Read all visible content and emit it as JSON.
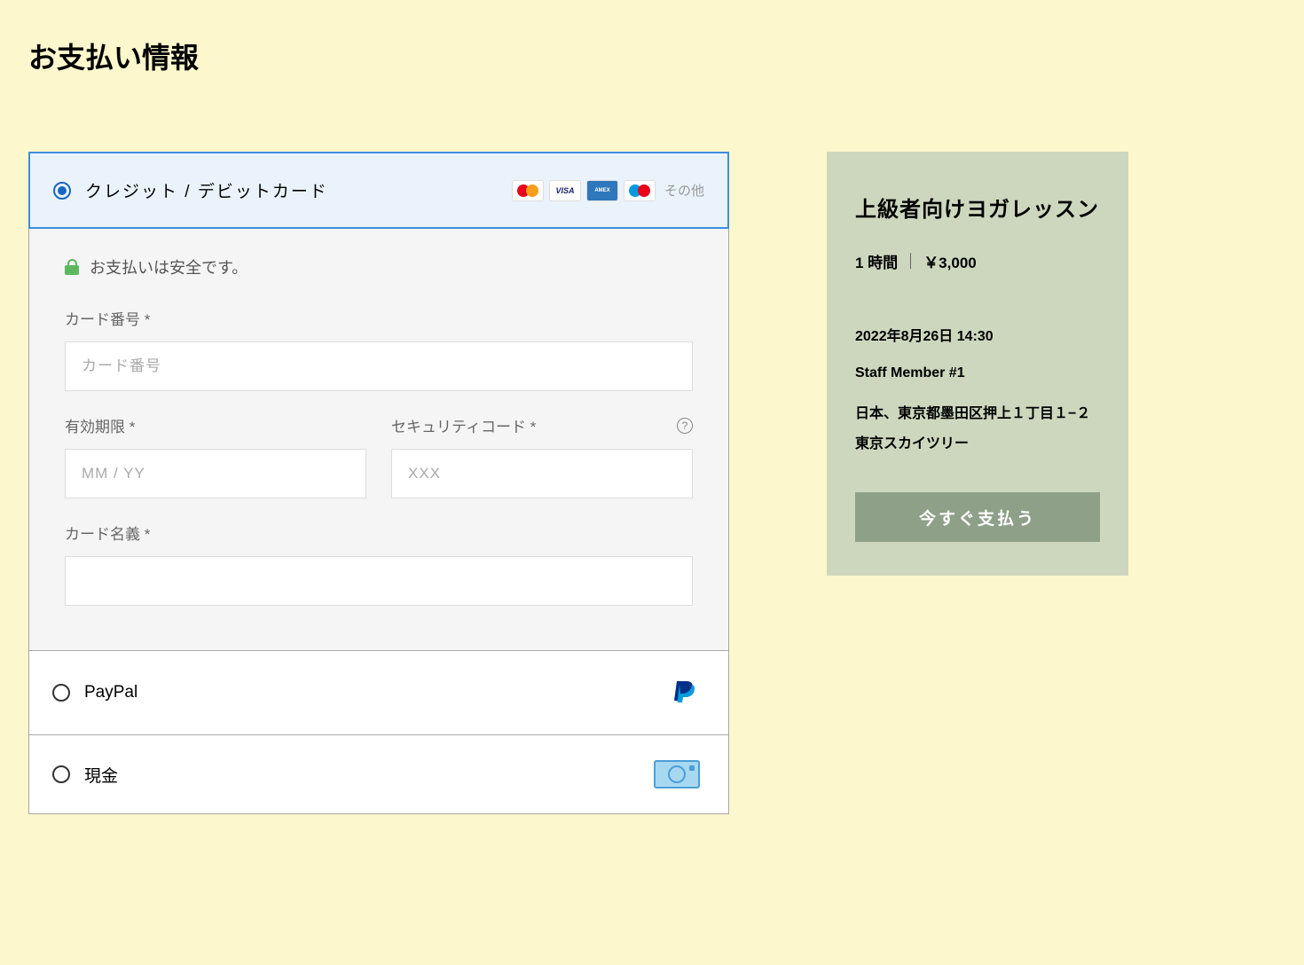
{
  "page": {
    "title": "お支払い情報"
  },
  "payment_methods": {
    "credit_card": {
      "label": "クレジット / デビットカード",
      "other_label": "その他",
      "secure_text": "お支払いは安全です。",
      "card_number_label": "カード番号 *",
      "card_number_placeholder": "カード番号",
      "expiry_label": "有効期限 *",
      "expiry_placeholder": "MM / YY",
      "cvc_label": "セキュリティコード *",
      "cvc_placeholder": "XXX",
      "card_name_label": "カード名義 *"
    },
    "paypal": {
      "label": "PayPal"
    },
    "cash": {
      "label": "現金"
    }
  },
  "summary": {
    "service_title": "上級者向けヨガレッスン",
    "duration": "1 時間",
    "price": "￥3,000",
    "datetime": "2022年8月26日 14:30",
    "staff": "Staff Member #1",
    "address": "日本、東京都墨田区押上１丁目１−２ 東京スカイツリー",
    "pay_button": "今すぐ支払う"
  }
}
